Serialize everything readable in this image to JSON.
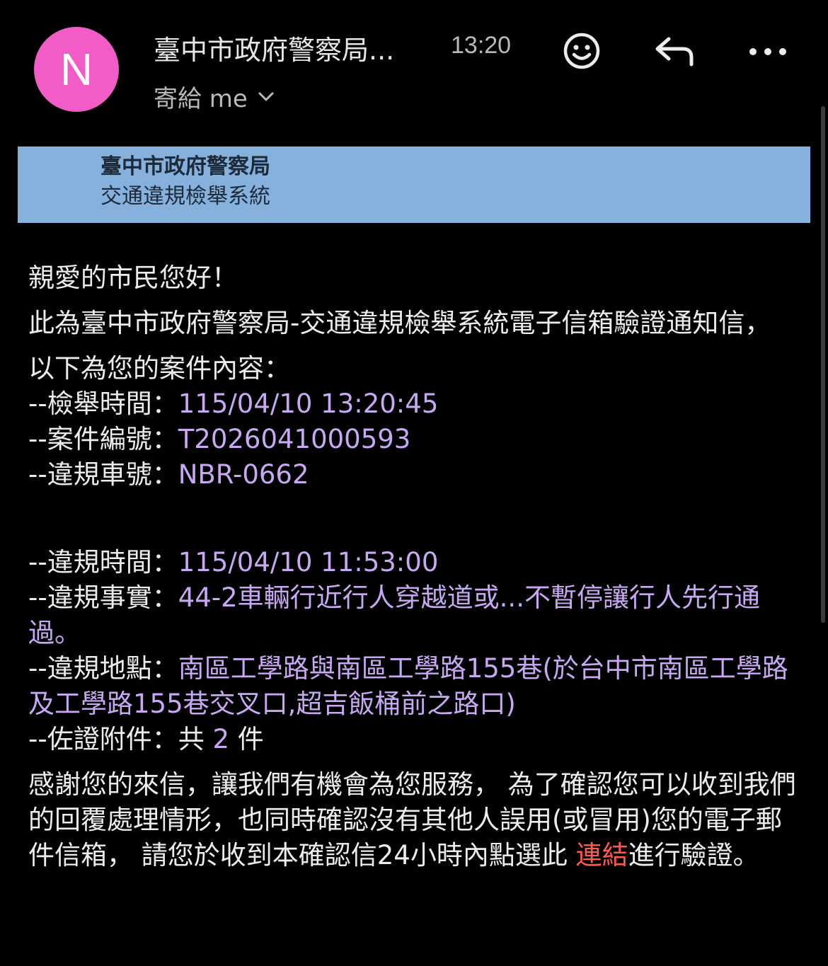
{
  "header": {
    "avatar_letter": "N",
    "avatar_color": "#f25cc6",
    "sender": "臺中市政府警察局...",
    "time": "13:20",
    "recipient": "寄給 me"
  },
  "banner": {
    "org": "臺中市政府警察局",
    "system": "交通違規檢舉系統",
    "background": "#86b1dc"
  },
  "body": {
    "greeting": "親愛的市民您好！",
    "intro": "此為臺中市政府警察局-交通違規檢舉系統電子信箱驗證通知信，",
    "case_heading": "以下為您的案件內容：",
    "report_time_label": "--檢舉時間：",
    "report_time": "115/04/10 13:20:45",
    "case_no_label": "--案件編號：",
    "case_no": "T2026041000593",
    "plate_label": "--違規車號：",
    "plate": "NBR-0662",
    "violation_time_label": "--違規時間：",
    "violation_time": "115/04/10 11:53:00",
    "violation_fact_label": "--違規事實：",
    "violation_fact": "44-2車輛行近行人穿越道或...不暫停讓行人先行通過。",
    "location_label": "--違規地點：",
    "location": "南區工學路與南區工學路155巷(於台中市南區工學路及工學路155巷交叉口,超吉飯桶前之路口)",
    "attachments_label_prefix": "--佐證附件：共 ",
    "attachments_count": "2",
    "attachments_label_suffix": " 件",
    "closing_before_link": "感謝您的來信，讓我們有機會為您服務， 為了確認您可以收到我們的回覆處理情形，也同時確認沒有其他人誤用(或冒用)您的電子郵件信箱， 請您於收到本確認信24小時內點選此 ",
    "link_text": "連結",
    "closing_after_link": "進行驗證。"
  }
}
